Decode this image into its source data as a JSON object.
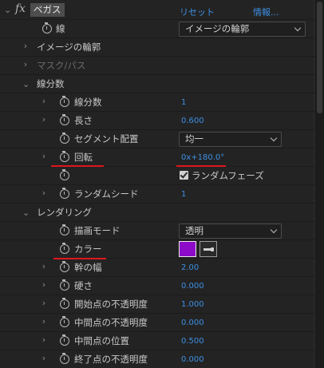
{
  "header": {
    "fx": "fx",
    "effect_name": "ベガス",
    "reset": "リセット",
    "info": "情報..."
  },
  "colors": {
    "accent_value": "#3d8fe3",
    "color_swatch": "#8c0ac8",
    "annotation_underline": "#e0151d"
  },
  "rows": {
    "line_label": "線",
    "line_dropdown": "イメージの輪郭",
    "image_outline": "イメージの輪郭",
    "mask_path": "マスク/パス",
    "segments_group": "線分数",
    "segments_label": "線分数",
    "segments_value": "1",
    "length_label": "長さ",
    "length_value": "0.600",
    "seg_distribution_label": "セグメント配置",
    "seg_distribution_dropdown": "均一",
    "rotation_label": "回転",
    "rotation_value": "0x+180.0°",
    "random_phase_label": "ランダムフェーズ",
    "random_phase_checked": true,
    "random_seed_label": "ランダムシード",
    "random_seed_value": "1",
    "rendering_group": "レンダリング",
    "blend_mode_label": "描画モード",
    "blend_mode_dropdown": "透明",
    "color_label": "カラー",
    "width_label": "幹の幅",
    "width_value": "2.00",
    "hardness_label": "硬さ",
    "hardness_value": "0.000",
    "start_opacity_label": "開始点の不透明度",
    "start_opacity_value": "1.000",
    "mid_opacity_label": "中間点の不透明度",
    "mid_opacity_value": "0.000",
    "mid_position_label": "中間点の位置",
    "mid_position_value": "0.500",
    "end_opacity_label": "終了点の不透明度",
    "end_opacity_value": "0.000"
  }
}
